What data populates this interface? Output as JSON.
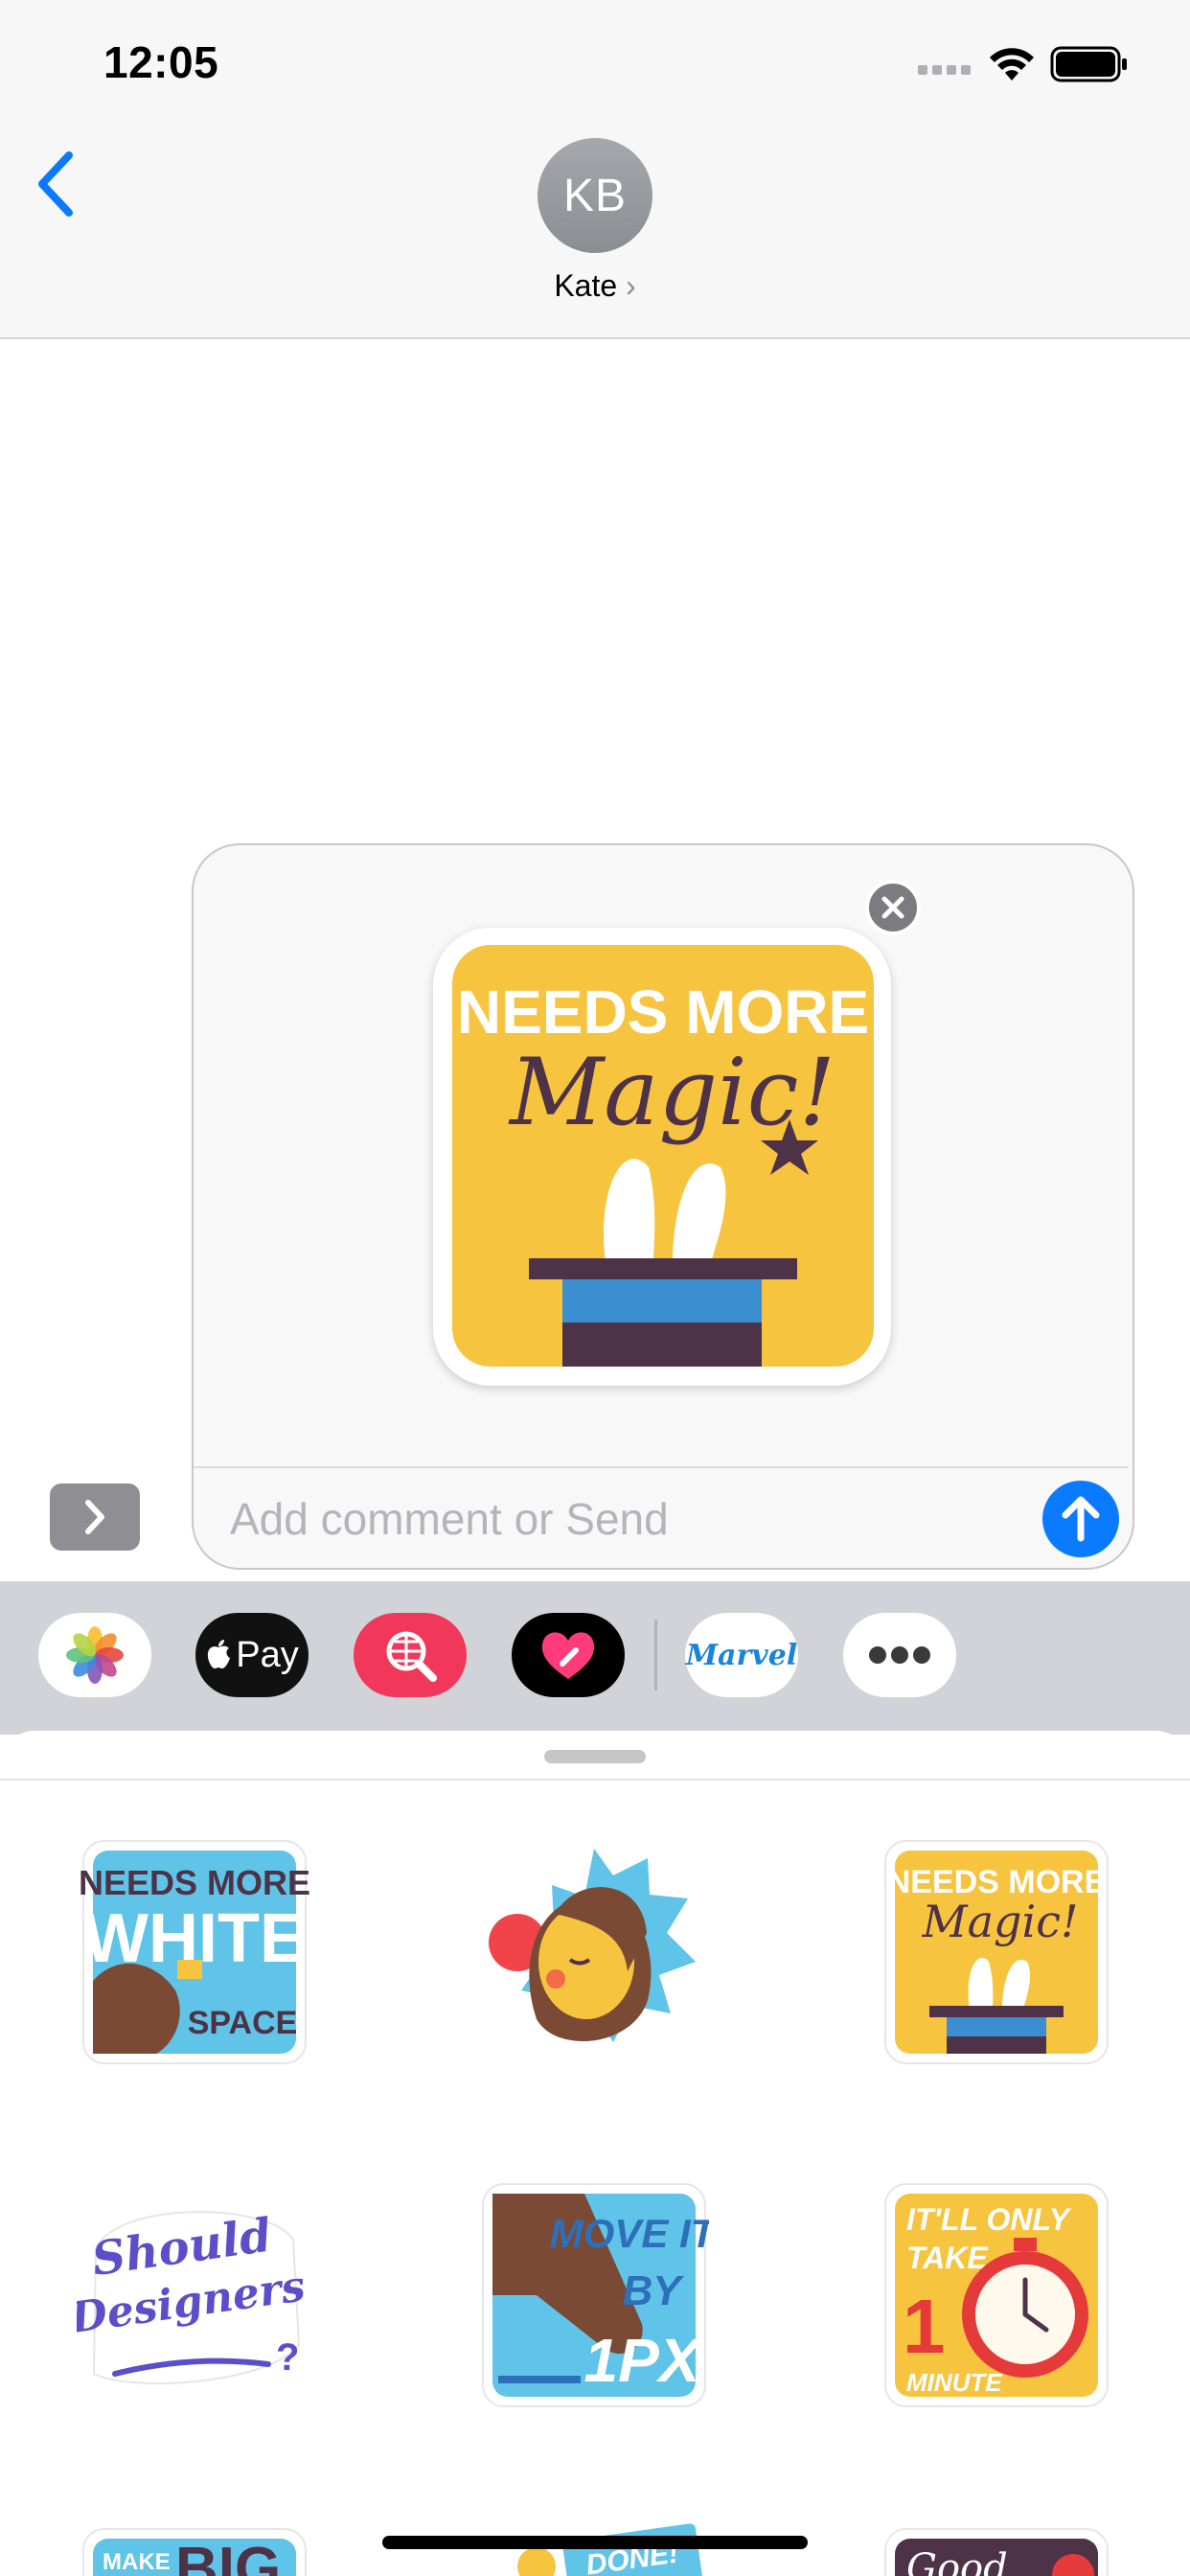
{
  "status_bar": {
    "time": "12:05"
  },
  "header": {
    "avatar_initials": "KB",
    "contact_name": "Kate",
    "contact_chevron": "›"
  },
  "compose": {
    "placeholder": "Add comment or Send",
    "selected_sticker": {
      "line1": "NEEDS MORE",
      "line2": "Magic!"
    }
  },
  "app_drawer": {
    "apps": [
      {
        "name": "Photos"
      },
      {
        "name": "Apple Pay",
        "label": "Pay"
      },
      {
        "name": "Search Images"
      },
      {
        "name": "Digital Touch"
      },
      {
        "name": "Marvel",
        "label": "Marvel"
      },
      {
        "name": "More"
      }
    ]
  },
  "stickers": [
    {
      "line1": "NEEDS MORE",
      "line2": "WHITE",
      "line3": "SPACE"
    },
    {
      "label": "facepalm"
    },
    {
      "line1": "NEEDS MORE",
      "line2": "Magic!"
    },
    {
      "line1": "Should",
      "line2": "Designers",
      "line3": "?"
    },
    {
      "line1": "MOVE IT",
      "line2": "BY",
      "line3": "1PX"
    },
    {
      "line1": "IT'LL ONLY",
      "line2": "TAKE",
      "line3": "1",
      "line4": "MINUTE"
    },
    {
      "line1": "MAKE",
      "line2": "BIG"
    },
    {
      "line1": "DONE!"
    },
    {
      "line1": "Good"
    }
  ],
  "colors": {
    "accent": "#0a7aff",
    "sticker_yellow": "#f7c440",
    "sticker_blue": "#5fc4e8",
    "sticker_purple": "#4e3247"
  }
}
